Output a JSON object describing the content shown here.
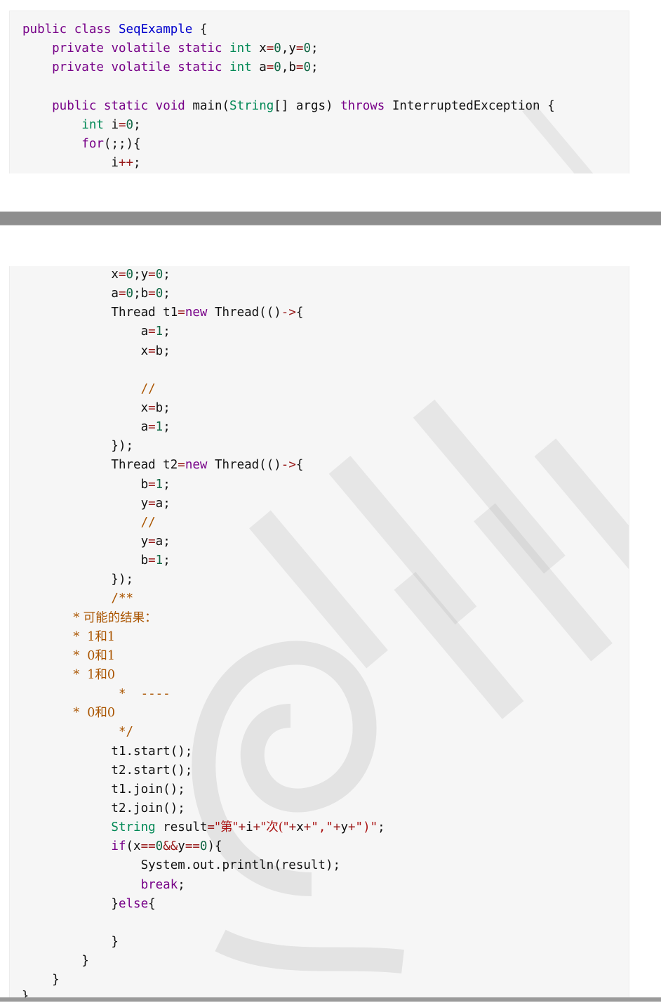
{
  "code_top": [
    [
      {
        "t": "public ",
        "c": "kw"
      },
      {
        "t": "class ",
        "c": "kw"
      },
      {
        "t": "SeqExample",
        "c": "cls"
      },
      {
        "t": " {"
      }
    ],
    [
      {
        "t": "    private ",
        "c": "kw"
      },
      {
        "t": "volatile ",
        "c": "kw"
      },
      {
        "t": "static ",
        "c": "kw"
      },
      {
        "t": "int ",
        "c": "ty"
      },
      {
        "t": "x"
      },
      {
        "t": "=",
        "c": "op"
      },
      {
        "t": "0",
        "c": "num"
      },
      {
        "t": ",y"
      },
      {
        "t": "=",
        "c": "op"
      },
      {
        "t": "0",
        "c": "num"
      },
      {
        "t": ";"
      }
    ],
    [
      {
        "t": "    private ",
        "c": "kw"
      },
      {
        "t": "volatile ",
        "c": "kw"
      },
      {
        "t": "static ",
        "c": "kw"
      },
      {
        "t": "int ",
        "c": "ty"
      },
      {
        "t": "a"
      },
      {
        "t": "=",
        "c": "op"
      },
      {
        "t": "0",
        "c": "num"
      },
      {
        "t": ",b"
      },
      {
        "t": "=",
        "c": "op"
      },
      {
        "t": "0",
        "c": "num"
      },
      {
        "t": ";"
      }
    ],
    [
      {
        "t": ""
      }
    ],
    [
      {
        "t": "    public ",
        "c": "kw"
      },
      {
        "t": "static ",
        "c": "kw"
      },
      {
        "t": "void ",
        "c": "kw"
      },
      {
        "t": "main("
      },
      {
        "t": "String",
        "c": "ty"
      },
      {
        "t": "[] args) "
      },
      {
        "t": "throws ",
        "c": "kw"
      },
      {
        "t": "InterruptedException {"
      }
    ],
    [
      {
        "t": "        int ",
        "c": "ty"
      },
      {
        "t": "i"
      },
      {
        "t": "=",
        "c": "op"
      },
      {
        "t": "0",
        "c": "num"
      },
      {
        "t": ";"
      }
    ],
    [
      {
        "t": "        for",
        "c": "kw"
      },
      {
        "t": "(;;){"
      }
    ],
    [
      {
        "t": "            i"
      },
      {
        "t": "++",
        "c": "op"
      },
      {
        "t": ";"
      }
    ]
  ],
  "code_bottom": [
    [
      {
        "t": "            x"
      },
      {
        "t": "=",
        "c": "op"
      },
      {
        "t": "0",
        "c": "num"
      },
      {
        "t": ";y"
      },
      {
        "t": "=",
        "c": "op"
      },
      {
        "t": "0",
        "c": "num"
      },
      {
        "t": ";"
      }
    ],
    [
      {
        "t": "            a"
      },
      {
        "t": "=",
        "c": "op"
      },
      {
        "t": "0",
        "c": "num"
      },
      {
        "t": ";b"
      },
      {
        "t": "=",
        "c": "op"
      },
      {
        "t": "0",
        "c": "num"
      },
      {
        "t": ";"
      }
    ],
    [
      {
        "t": "            Thread t1"
      },
      {
        "t": "=",
        "c": "op"
      },
      {
        "t": "new ",
        "c": "kw"
      },
      {
        "t": "Thread(()"
      },
      {
        "t": "->",
        "c": "op"
      },
      {
        "t": "{"
      }
    ],
    [
      {
        "t": "                a"
      },
      {
        "t": "=",
        "c": "op"
      },
      {
        "t": "1",
        "c": "num"
      },
      {
        "t": ";"
      }
    ],
    [
      {
        "t": "                x"
      },
      {
        "t": "=",
        "c": "op"
      },
      {
        "t": "b;"
      }
    ],
    [
      {
        "t": ""
      }
    ],
    [
      {
        "t": "                //",
        "c": "cm"
      }
    ],
    [
      {
        "t": "                x"
      },
      {
        "t": "=",
        "c": "op"
      },
      {
        "t": "b;"
      }
    ],
    [
      {
        "t": "                a"
      },
      {
        "t": "=",
        "c": "op"
      },
      {
        "t": "1",
        "c": "num"
      },
      {
        "t": ";"
      }
    ],
    [
      {
        "t": "            });"
      }
    ],
    [
      {
        "t": "            Thread t2"
      },
      {
        "t": "=",
        "c": "op"
      },
      {
        "t": "new ",
        "c": "kw"
      },
      {
        "t": "Thread(()"
      },
      {
        "t": "->",
        "c": "op"
      },
      {
        "t": "{"
      }
    ],
    [
      {
        "t": "                b"
      },
      {
        "t": "=",
        "c": "op"
      },
      {
        "t": "1",
        "c": "num"
      },
      {
        "t": ";"
      }
    ],
    [
      {
        "t": "                y"
      },
      {
        "t": "=",
        "c": "op"
      },
      {
        "t": "a;"
      }
    ],
    [
      {
        "t": "                //",
        "c": "cm"
      }
    ],
    [
      {
        "t": "                y"
      },
      {
        "t": "=",
        "c": "op"
      },
      {
        "t": "a;"
      }
    ],
    [
      {
        "t": "                b"
      },
      {
        "t": "=",
        "c": "op"
      },
      {
        "t": "1",
        "c": "num"
      },
      {
        "t": ";"
      }
    ],
    [
      {
        "t": "            });"
      }
    ],
    [
      {
        "t": "            /**",
        "c": "cm"
      }
    ],
    [
      {
        "t": "             * 可能的结果：",
        "c": "cm"
      }
    ],
    [
      {
        "t": "             *  1和1",
        "c": "cm"
      }
    ],
    [
      {
        "t": "             *  0和1",
        "c": "cm"
      }
    ],
    [
      {
        "t": "             *  1和0",
        "c": "cm"
      }
    ],
    [
      {
        "t": "             *  ----",
        "c": "cm"
      }
    ],
    [
      {
        "t": "             *  0和0",
        "c": "cm"
      }
    ],
    [
      {
        "t": "             */",
        "c": "cm"
      }
    ],
    [
      {
        "t": "            t1.start();"
      }
    ],
    [
      {
        "t": "            t2.start();"
      }
    ],
    [
      {
        "t": "            t1.join();"
      }
    ],
    [
      {
        "t": "            t2.join();"
      }
    ],
    [
      {
        "t": "            String ",
        "c": "ty"
      },
      {
        "t": "result"
      },
      {
        "t": "=",
        "c": "op"
      },
      {
        "t": "\"第\"",
        "c": "str"
      },
      {
        "t": "+",
        "c": "op"
      },
      {
        "t": "i"
      },
      {
        "t": "+",
        "c": "op"
      },
      {
        "t": "\"次(\"",
        "c": "str"
      },
      {
        "t": "+",
        "c": "op"
      },
      {
        "t": "x"
      },
      {
        "t": "+",
        "c": "op"
      },
      {
        "t": "\",\"",
        "c": "str"
      },
      {
        "t": "+",
        "c": "op"
      },
      {
        "t": "y"
      },
      {
        "t": "+",
        "c": "op"
      },
      {
        "t": "\")\"",
        "c": "str"
      },
      {
        "t": ";"
      }
    ],
    [
      {
        "t": "            if",
        "c": "kw"
      },
      {
        "t": "(x"
      },
      {
        "t": "==",
        "c": "op"
      },
      {
        "t": "0",
        "c": "num"
      },
      {
        "t": "&&",
        "c": "op"
      },
      {
        "t": "y"
      },
      {
        "t": "==",
        "c": "op"
      },
      {
        "t": "0",
        "c": "num"
      },
      {
        "t": "){"
      }
    ],
    [
      {
        "t": "                System.out.println(result);"
      }
    ],
    [
      {
        "t": "                break",
        "c": "kw"
      },
      {
        "t": ";"
      }
    ],
    [
      {
        "t": "            }"
      },
      {
        "t": "else",
        "c": "kw"
      },
      {
        "t": "{"
      }
    ],
    [
      {
        "t": ""
      }
    ],
    [
      {
        "t": "            }"
      }
    ],
    [
      {
        "t": "        }"
      }
    ],
    [
      {
        "t": "    }"
      }
    ]
  ],
  "closing_brace": "}",
  "colors": {
    "panel_bg": "#f6f6f6",
    "divider": "#8e8e8e",
    "keyword": "#770088",
    "type": "#008855",
    "number": "#116644",
    "comment": "#aa5500",
    "string": "#aa1111"
  }
}
